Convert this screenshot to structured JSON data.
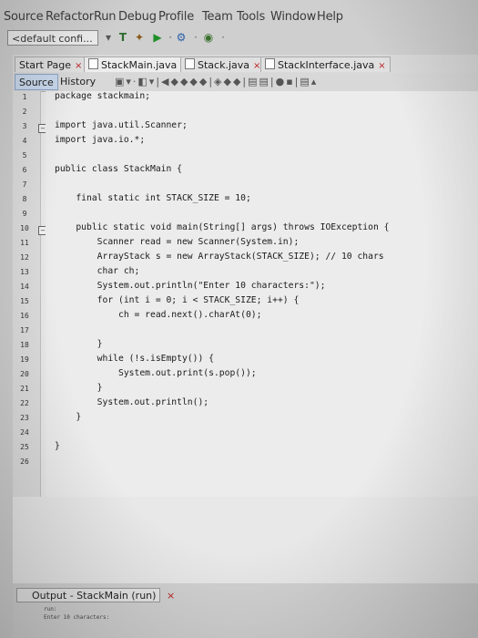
{
  "menu": [
    "Source",
    "Refactor",
    "Run",
    "Debug",
    "Profile",
    "Team",
    "Tools",
    "Window",
    "Help"
  ],
  "toolbar": {
    "config_value": "<default confi..."
  },
  "file_tabs": [
    {
      "label": "Start Page"
    },
    {
      "label": "StackMain.java"
    },
    {
      "label": "Stack.java"
    },
    {
      "label": "StackInterface.java"
    }
  ],
  "close_glyph": "×",
  "view_tabs": {
    "source": "Source",
    "history": "History"
  },
  "line_numbers": [
    "1",
    "2",
    "3",
    "4",
    "5",
    "6",
    "7",
    "8",
    "9",
    "10",
    "11",
    "12",
    "13",
    "14",
    "15",
    "16",
    "17",
    "18",
    "19",
    "20",
    "21",
    "22",
    "23",
    "24",
    "25",
    "26"
  ],
  "code_lines": [
    "package stackmain;",
    "",
    "import java.util.Scanner;",
    "import java.io.*;",
    "",
    "public class StackMain {",
    "",
    "    final static int STACK_SIZE = 10;",
    "",
    "    public static void main(String[] args) throws IOException {",
    "        Scanner read = new Scanner(System.in);",
    "        ArrayStack s = new ArrayStack(STACK_SIZE); // 10 chars",
    "        char ch;",
    "        System.out.println(\"Enter 10 characters:\");",
    "        for (int i = 0; i < STACK_SIZE; i++) {",
    "            ch = read.next().charAt(0);",
    "",
    "        }",
    "        while (!s.isEmpty()) {",
    "            System.out.print(s.pop());",
    "        }",
    "        System.out.println();",
    "    }",
    "",
    "}",
    ""
  ],
  "output": {
    "tab_label": "Output - StackMain (run)",
    "lines": [
      "run:",
      "Enter 10 characters:"
    ]
  },
  "colors": {
    "keyword": "#1d27a8",
    "string": "#c0392b",
    "comment": "#7a7a7a",
    "current_line": "#cbd3e4"
  }
}
